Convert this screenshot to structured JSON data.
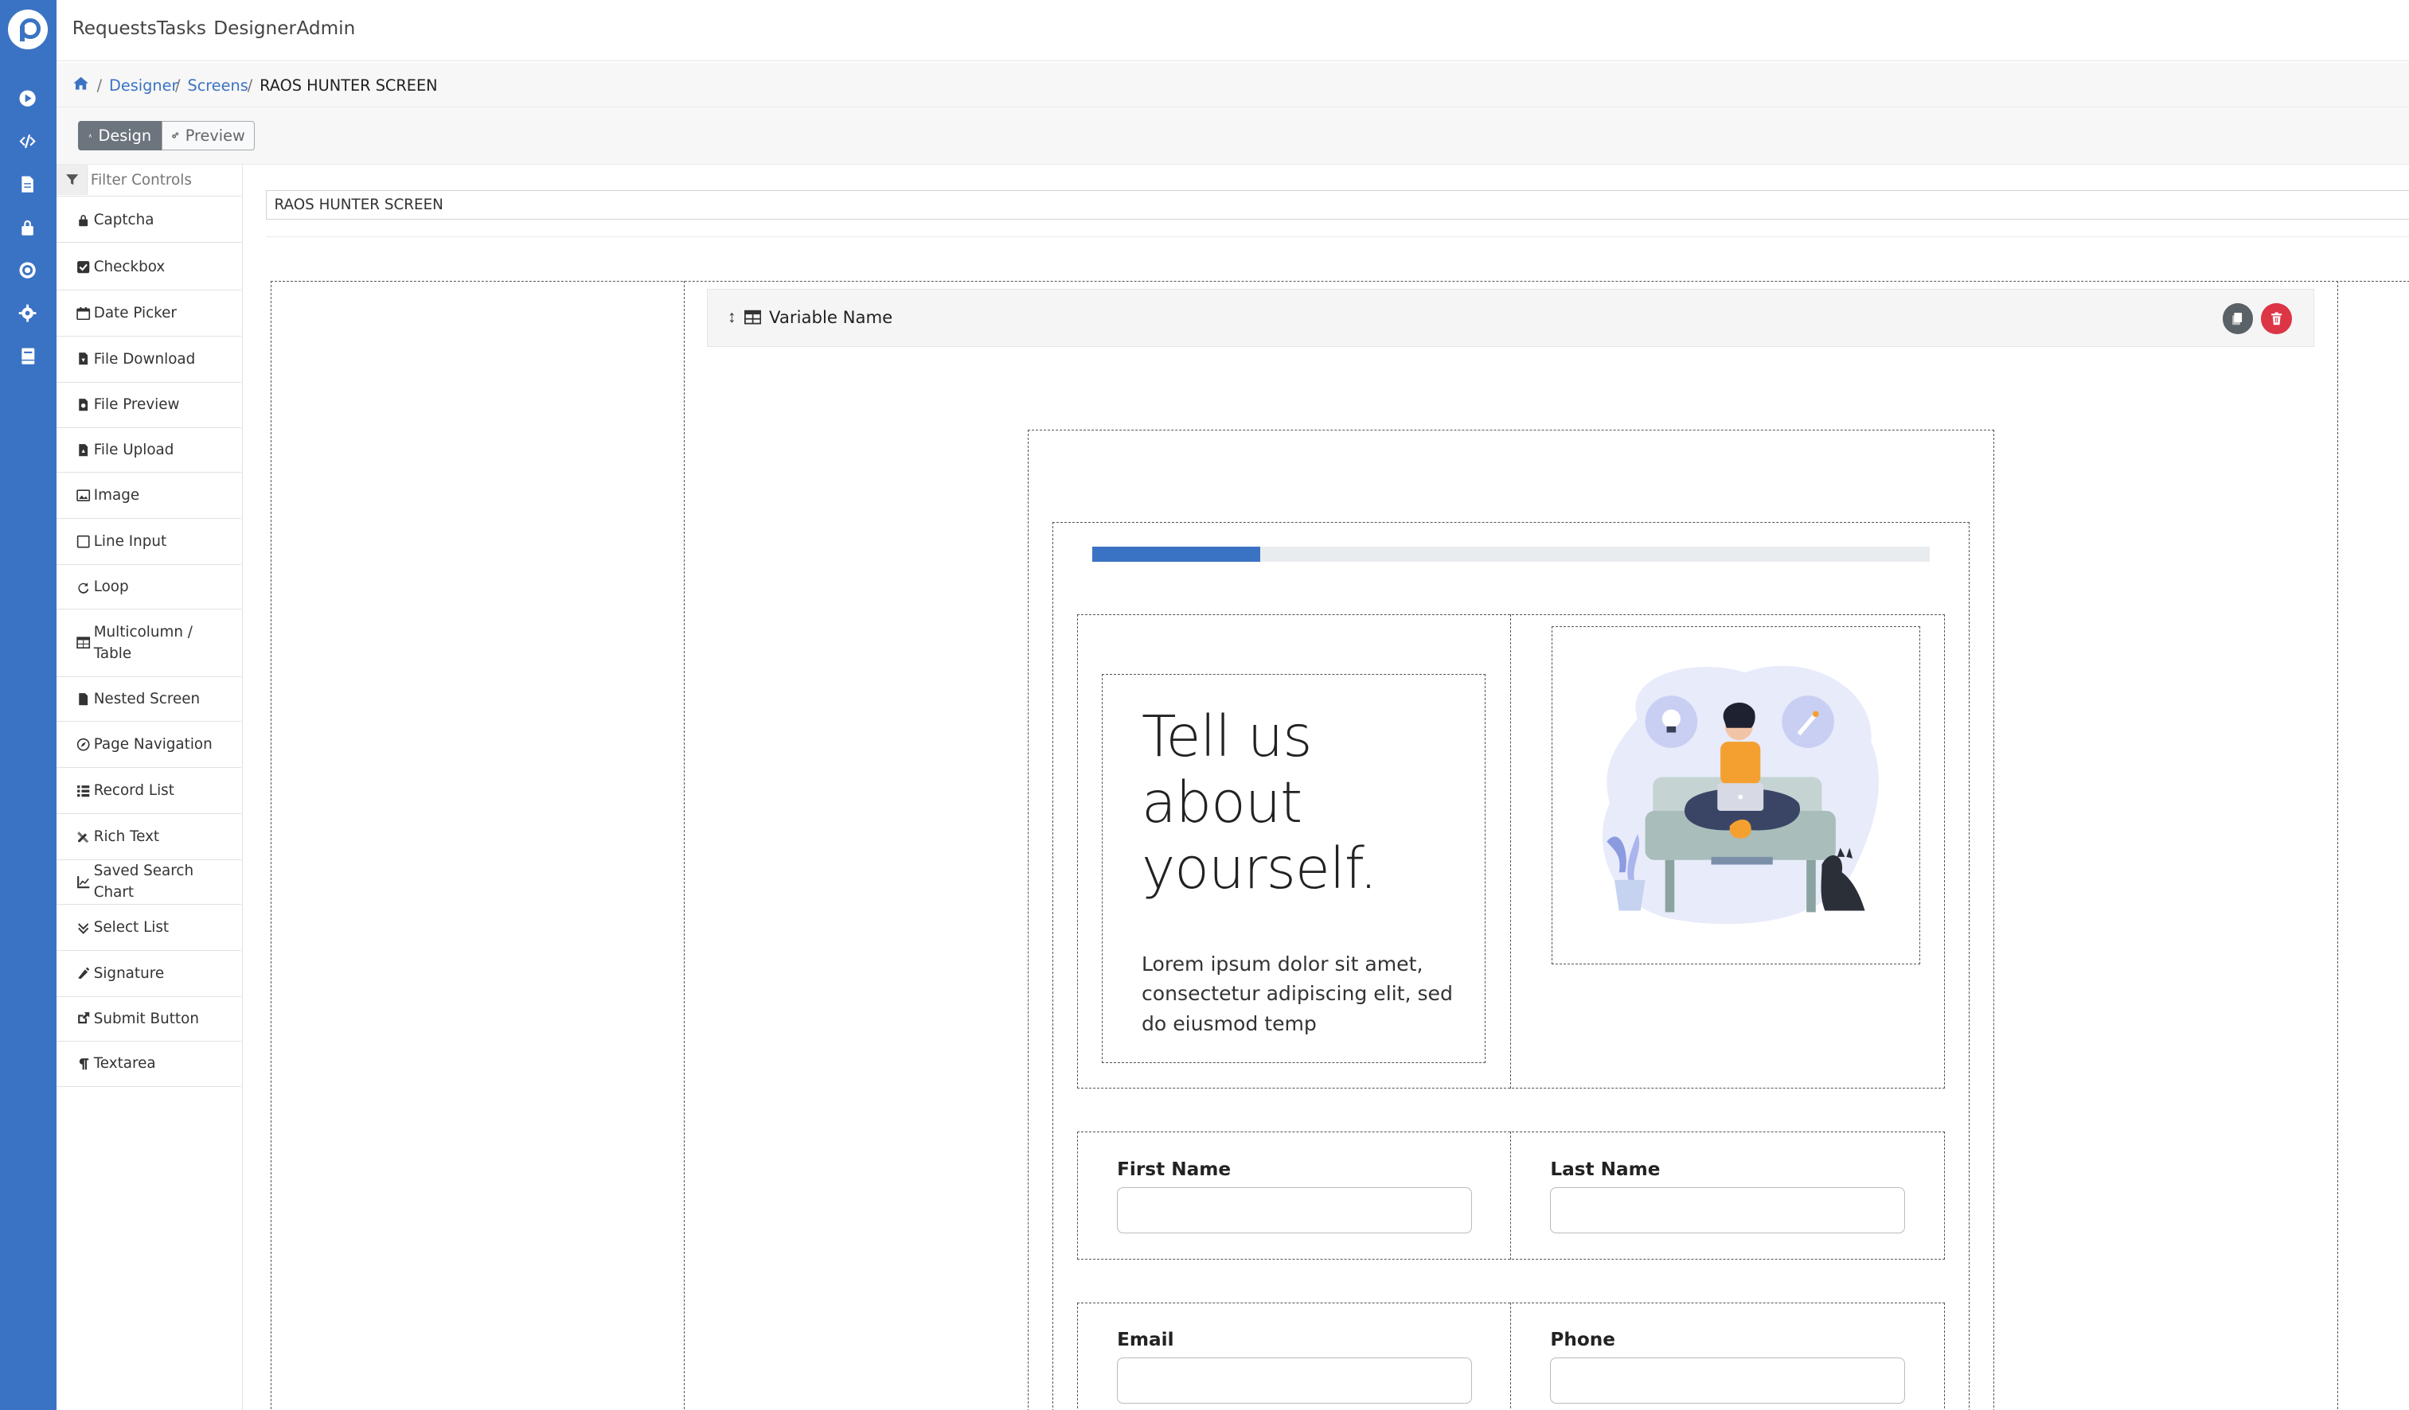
{
  "topnav": {
    "items": [
      "Requests",
      "Tasks",
      "Designer",
      "Admin"
    ]
  },
  "breadcrumb": {
    "items": [
      "Designer",
      "Screens"
    ],
    "current": "RAOS HUNTER SCREEN",
    "separator": "/"
  },
  "toolbar": {
    "design_label": "Design",
    "preview_label": "Preview"
  },
  "controls": {
    "filter_placeholder": "Filter Controls",
    "items": [
      {
        "label": "Captcha",
        "icon": "lock-icon"
      },
      {
        "label": "Checkbox",
        "icon": "checkbox-icon"
      },
      {
        "label": "Date Picker",
        "icon": "calendar-icon"
      },
      {
        "label": "File Download",
        "icon": "file-download-icon"
      },
      {
        "label": "File Preview",
        "icon": "file-preview-icon"
      },
      {
        "label": "File Upload",
        "icon": "file-upload-icon"
      },
      {
        "label": "Image",
        "icon": "image-icon"
      },
      {
        "label": "Line Input",
        "icon": "square-icon"
      },
      {
        "label": "Loop",
        "icon": "redo-icon"
      },
      {
        "label": "Multicolumn / Table",
        "icon": "table-icon"
      },
      {
        "label": "Nested Screen",
        "icon": "file-icon"
      },
      {
        "label": "Page Navigation",
        "icon": "compass-icon"
      },
      {
        "label": "Record List",
        "icon": "list-icon"
      },
      {
        "label": "Rich Text",
        "icon": "pencil-ruler-icon"
      },
      {
        "label": "Saved Search Chart",
        "icon": "chart-icon"
      },
      {
        "label": "Select List",
        "icon": "angle-double-down-icon"
      },
      {
        "label": "Signature",
        "icon": "signature-icon"
      },
      {
        "label": "Submit Button",
        "icon": "external-link-icon"
      },
      {
        "label": "Textarea",
        "icon": "paragraph-icon"
      }
    ]
  },
  "screen": {
    "title_value": "RAOS HUNTER SCREEN",
    "variable_name": "Variable Name",
    "progress": 0.2,
    "headline": "Tell us about yourself.",
    "body": "Lorem ipsum dolor sit amet, consectetur adipiscing elit, sed do eiusmod temp",
    "fields": {
      "first_name": "First Name",
      "last_name": "Last Name",
      "email": "Email",
      "phone": "Phone"
    }
  },
  "colors": {
    "primary": "#3b73c4",
    "danger": "#dc3545",
    "secondary": "#6c757d"
  }
}
